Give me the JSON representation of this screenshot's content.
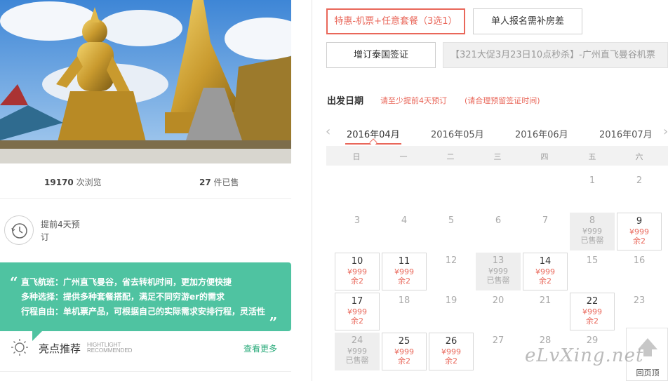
{
  "stats": {
    "views_count": "19170",
    "views_label": "次浏览",
    "sold_count": "27",
    "sold_label": "件已售"
  },
  "booking_note": "提前4天预订",
  "features": [
    "直飞航班：广州直飞曼谷，省去转机时间，更加方便快捷",
    "多种选择：提供多种套餐搭配，满足不同穷游er的需求",
    "行程自由：单机票产品，可根据自己的实际需求安排行程，灵活性"
  ],
  "quote_open": "“",
  "quote_close": "„",
  "highlights": {
    "title": "亮点推荐",
    "subtitle_line1": "HIGHTLIGHT",
    "subtitle_line2": "RECOMMENDED",
    "more": "查看更多",
    "icon": "sun-icon"
  },
  "options": {
    "combo": "特惠-机票+任意套餐（3选1）",
    "single": "单人报名需补房差",
    "visa": "增订泰国签证",
    "banner": "【321大促3月23日10点秒杀】-广州直飞曼谷机票"
  },
  "date_section": {
    "label": "出发日期",
    "note1": "请至少提前4天预订",
    "note2": "(请合理预留签证时间)"
  },
  "months": [
    "2016年04月",
    "2016年05月",
    "2016年06月",
    "2016年07月"
  ],
  "active_month": "2016年04月",
  "weekdays": [
    "日",
    "一",
    "二",
    "三",
    "四",
    "五",
    "六"
  ],
  "calendar": [
    {
      "day": "1",
      "state": "plain"
    },
    {
      "day": "2",
      "state": "plain"
    },
    {
      "day": "3",
      "state": "plain"
    },
    {
      "day": "4",
      "state": "plain"
    },
    {
      "day": "5",
      "state": "plain"
    },
    {
      "day": "6",
      "state": "plain"
    },
    {
      "day": "7",
      "state": "plain"
    },
    {
      "day": "8",
      "state": "sold",
      "price": "¥999",
      "status": "已售罄"
    },
    {
      "day": "9",
      "state": "avail",
      "price": "¥999",
      "status": "余2"
    },
    {
      "day": "10",
      "state": "avail",
      "price": "¥999",
      "status": "余2"
    },
    {
      "day": "11",
      "state": "avail",
      "price": "¥999",
      "status": "余2"
    },
    {
      "day": "12",
      "state": "plain"
    },
    {
      "day": "13",
      "state": "sold",
      "price": "¥999",
      "status": "已售罄"
    },
    {
      "day": "14",
      "state": "avail",
      "price": "¥999",
      "status": "余2"
    },
    {
      "day": "15",
      "state": "plain"
    },
    {
      "day": "16",
      "state": "plain"
    },
    {
      "day": "17",
      "state": "avail",
      "price": "¥999",
      "status": "余2"
    },
    {
      "day": "18",
      "state": "plain"
    },
    {
      "day": "19",
      "state": "plain"
    },
    {
      "day": "20",
      "state": "plain"
    },
    {
      "day": "21",
      "state": "plain"
    },
    {
      "day": "22",
      "state": "avail",
      "price": "¥999",
      "status": "余2"
    },
    {
      "day": "23",
      "state": "plain"
    },
    {
      "day": "24",
      "state": "sold",
      "price": "¥999",
      "status": "已售罄"
    },
    {
      "day": "25",
      "state": "avail",
      "price": "¥999",
      "status": "余2"
    },
    {
      "day": "26",
      "state": "avail",
      "price": "¥999",
      "status": "余2"
    },
    {
      "day": "27",
      "state": "plain"
    },
    {
      "day": "28",
      "state": "plain"
    },
    {
      "day": "29",
      "state": "plain"
    }
  ],
  "back_to_top": "回页顶",
  "watermark": "eLvXing.net",
  "colors": {
    "accent": "#e9675a",
    "feature_bg": "#4fc3a1",
    "link_green": "#2bab7b"
  }
}
